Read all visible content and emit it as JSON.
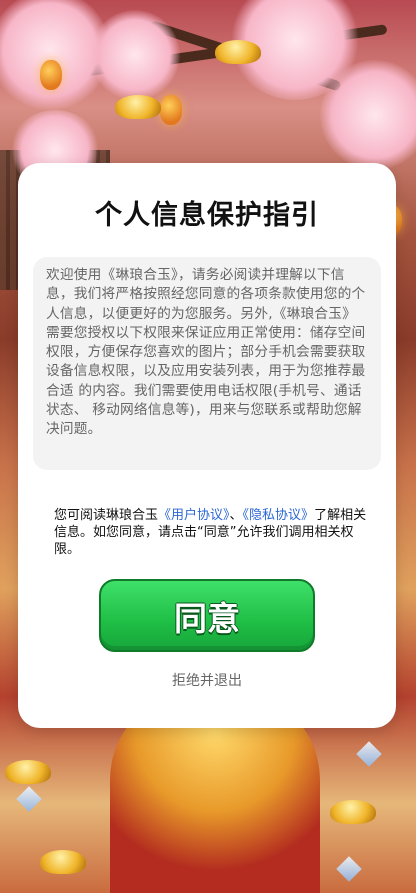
{
  "dialog": {
    "title": "个人信息保护指引",
    "notice_text": "欢迎使用《琳琅合玉》，请务必阅读并理解以下信息，我们将严格按照经您同意的各项条款使用您的个人信息，以便更好的为您服务。另外,《琳琅合玉》需要您授权以下权限来保证应用正常使用：储存空间权限，方便保存您喜欢的图片；部分手机会需要获取设备信息权限，以及应用安装列表，用于为您推荐最合适 的内容。我们需要使用电话权限(手机号、通话状态、 移动网络信息等)，用来与您联系或帮助您解决问题。",
    "consent_prefix": "您可阅读琳琅合玉",
    "user_agreement_link": "《用户协议》",
    "separator": "、",
    "privacy_policy_link": "《隐私协议》",
    "consent_suffix": "了解相关信息。如您同意，请点击“同意”允许我们调用相关权限。",
    "agree_button": "同意",
    "reject_button": "拒绝并退出"
  },
  "colors": {
    "agree_button": "#1fbe45",
    "link": "#2b67d6",
    "notice_background": "#f3f3f3"
  }
}
